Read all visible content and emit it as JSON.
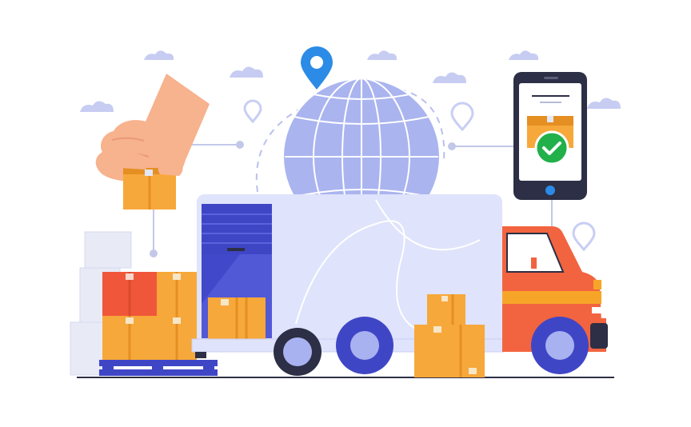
{
  "illustration": {
    "subject": "delivery-truck-logistics",
    "colors": {
      "background": "#ffffff",
      "truck_body": "#dfe3fb",
      "truck_outline": "#c9cff5",
      "cargo_door": "#3f46c6",
      "cab": "#f2643f",
      "cab_stripe": "#f7a528",
      "box": "#f7a83a",
      "box_dark": "#e58f22",
      "box_red": "#f0573a",
      "box_pale": "#e8eaf6",
      "globe": "#aab4ef",
      "globe_lines": "#ffffff",
      "wheel": "#3f46c6",
      "hub": "#a9b2f0",
      "pin": "#2b8be6",
      "phone": "#2c2f45",
      "phone_screen": "#ffffff",
      "check": "#22b04b",
      "hand": "#f7b28e",
      "cloud": "#c7ccf2",
      "connector": "#c3c8ea"
    },
    "icons": [
      "globe-icon",
      "location-pin-icon",
      "smartphone-icon",
      "checkmark-icon",
      "hand-icon",
      "package-box-icon",
      "delivery-truck-icon",
      "cloud-icon",
      "pallet-icon"
    ]
  }
}
